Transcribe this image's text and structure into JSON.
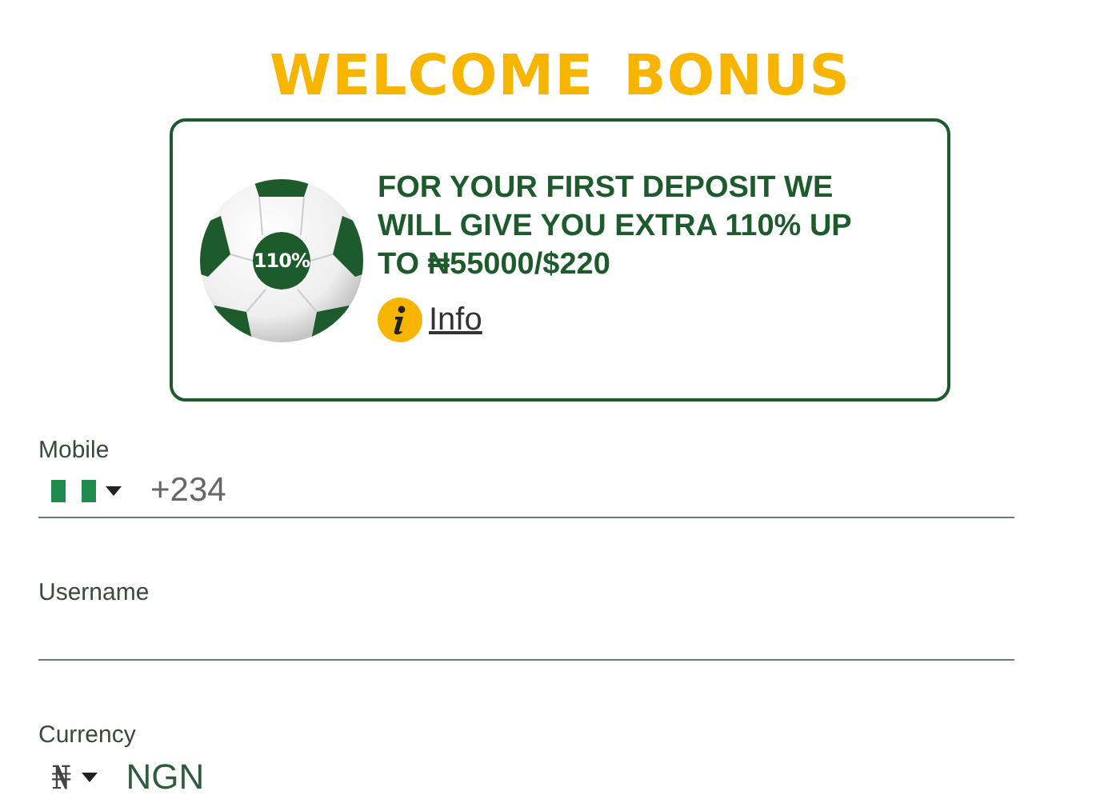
{
  "title": "WELCOME BONUS",
  "bonus": {
    "badge": "110%",
    "text": "FOR YOUR FIRST DEPOSIT WE WILL GIVE YOU EXTRA 110% UP TO ₦55000/$220",
    "info_link": "Info"
  },
  "fields": [
    {
      "kind": "phone",
      "label": "Mobile",
      "prefix": "+234"
    },
    {
      "kind": "text",
      "label": "Username"
    },
    {
      "kind": "select",
      "label": "Currency",
      "symbol": "₦",
      "value": "NGN"
    }
  ]
}
